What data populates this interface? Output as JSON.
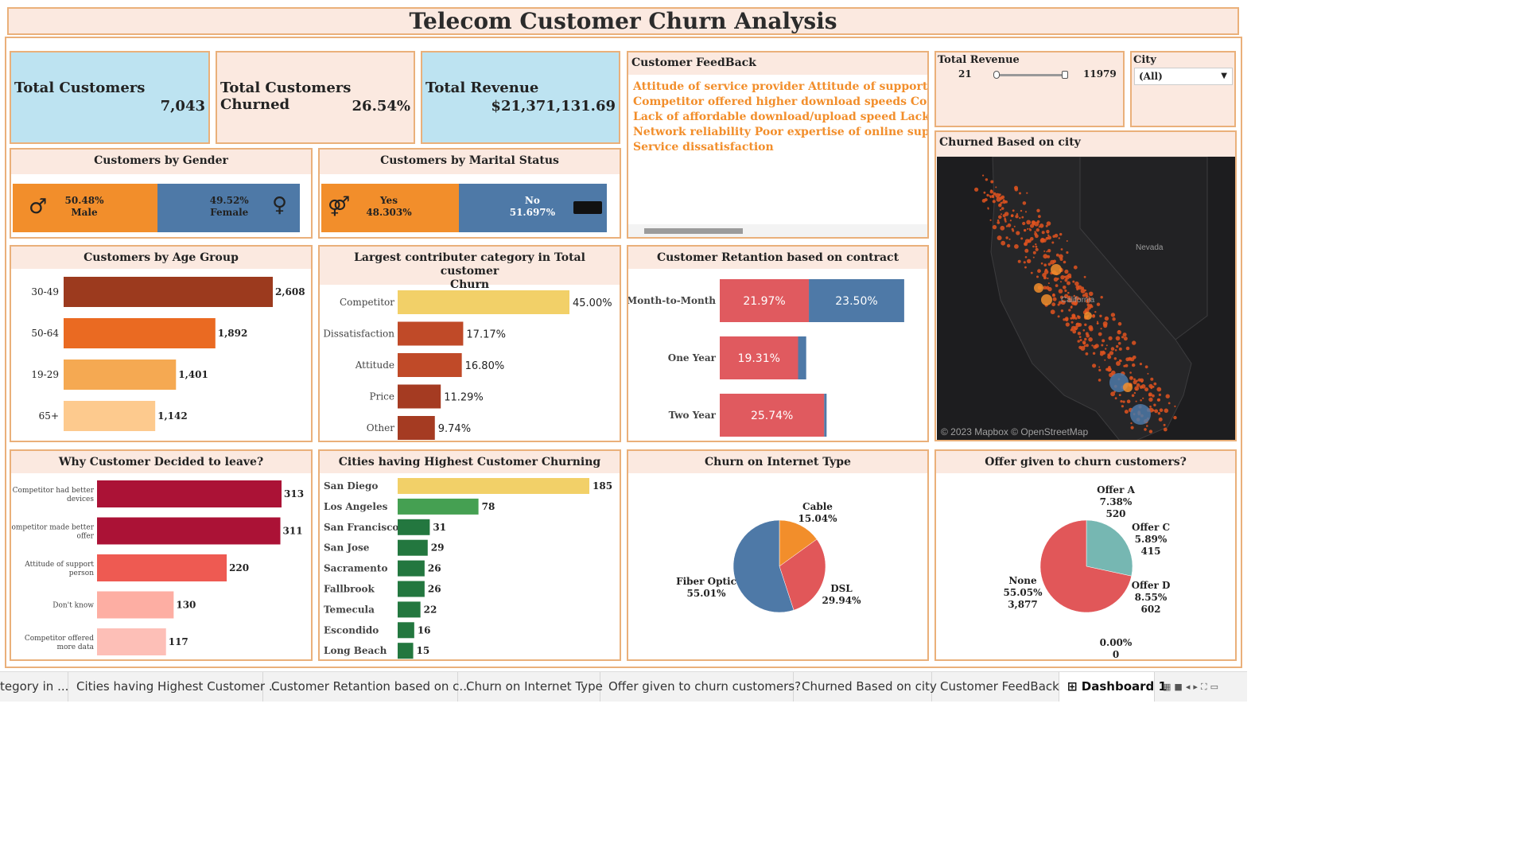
{
  "title": "Telecom Customer Churn Analysis",
  "kpis": {
    "total_customers": {
      "label": "Total Customers",
      "value": "7,043"
    },
    "churned": {
      "label": "Total Customers Churned",
      "value": "26.54%"
    },
    "revenue": {
      "label": "Total Revenue",
      "value": "$21,371,131.69"
    }
  },
  "feedback": {
    "title": "Customer FeedBack",
    "lines": [
      "Attitude of service provider  Attitude of support pers",
      "Competitor offered higher download speeds  Competi",
      "Lack of affordable download/upload speed  Lack of s",
      "Network reliability  Poor expertise of online support  P",
      "Service dissatisfaction"
    ]
  },
  "revenue_filter": {
    "title": "Total Revenue",
    "min": "21",
    "max": "11979"
  },
  "city_filter": {
    "title": "City",
    "value": "(All)"
  },
  "map": {
    "title": "Churned Based on city",
    "state_label": "Nevada",
    "state_label_ca": "California",
    "attribution": "© 2023 Mapbox © OpenStreetMap"
  },
  "gender": {
    "title": "Customers by Gender",
    "male_pct": "50.48%",
    "male_label": "Male",
    "female_pct": "49.52%",
    "female_label": "Female",
    "male_share": 50.48
  },
  "marital": {
    "title": "Customers by Marital Status",
    "yes_label": "Yes",
    "yes_pct": "48.303%",
    "no_label": "No",
    "no_pct": "51.697%",
    "yes_share": 48.303
  },
  "age": {
    "title": "Customers by Age Group",
    "rows": [
      {
        "label": "30-49",
        "value": 2608,
        "text": "2,608",
        "color": "#9c3a1e"
      },
      {
        "label": "50-64",
        "value": 1892,
        "text": "1,892",
        "color": "#ea6a22"
      },
      {
        "label": "19-29",
        "value": 1401,
        "text": "1,401",
        "color": "#f5a952"
      },
      {
        "label": "65+",
        "value": 1142,
        "text": "1,142",
        "color": "#fdca8e"
      }
    ]
  },
  "category": {
    "title_line1": "Largest contributer category in Total customer",
    "title_line2": "Churn",
    "rows": [
      {
        "label": "Competitor",
        "value": 45.0,
        "text": "45.00%",
        "color": "#f2d068"
      },
      {
        "label": "Dissatisfaction",
        "value": 17.17,
        "text": "17.17%",
        "color": "#c04a28"
      },
      {
        "label": "Attitude",
        "value": 16.8,
        "text": "16.80%",
        "color": "#c04a28"
      },
      {
        "label": "Price",
        "value": 11.29,
        "text": "11.29%",
        "color": "#a53b22"
      },
      {
        "label": "Other",
        "value": 9.74,
        "text": "9.74%",
        "color": "#a53b22"
      }
    ]
  },
  "retention": {
    "title": "Customer Retantion based on contract",
    "rows": [
      {
        "label": "Month-to-Month",
        "churned": 21.97,
        "churned_text": "21.97%",
        "stayed": 23.5,
        "stayed_text": "23.50%"
      },
      {
        "label": "One Year",
        "churned": 19.31,
        "churned_text": "19.31%",
        "stayed": 2.0,
        "stayed_text": ""
      },
      {
        "label": "Two Year",
        "churned": 25.74,
        "churned_text": "25.74%",
        "stayed": 0.6,
        "stayed_text": ""
      }
    ],
    "colors": {
      "churned": "#e05a5f",
      "stayed": "#4e79a7"
    }
  },
  "reasons": {
    "title": "Why Customer Decided to leave?",
    "rows": [
      {
        "l1": "Competitor had better",
        "l2": "devices",
        "value": 313,
        "text": "313",
        "color": "#ab1236"
      },
      {
        "l1": "Competitor made better",
        "l2": "offer",
        "value": 311,
        "text": "311",
        "color": "#ab1236"
      },
      {
        "l1": "Attitude of support",
        "l2": "person",
        "value": 220,
        "text": "220",
        "color": "#ee5a52"
      },
      {
        "l1": "Don't know",
        "l2": "",
        "value": 130,
        "text": "130",
        "color": "#fdaea3"
      },
      {
        "l1": "Competitor offered",
        "l2": "more data",
        "value": 117,
        "text": "117",
        "color": "#fdbfb7"
      }
    ]
  },
  "cities": {
    "title": "Cities having Highest Customer Churning",
    "rows": [
      {
        "label": "San Diego",
        "value": 185,
        "text": "185",
        "color": "#f2d068"
      },
      {
        "label": "Los Angeles",
        "value": 78,
        "text": "78",
        "color": "#45a052"
      },
      {
        "label": "San Francisco",
        "value": 31,
        "text": "31",
        "color": "#23773f"
      },
      {
        "label": "San Jose",
        "value": 29,
        "text": "29",
        "color": "#23773f"
      },
      {
        "label": "Sacramento",
        "value": 26,
        "text": "26",
        "color": "#23773f"
      },
      {
        "label": "Fallbrook",
        "value": 26,
        "text": "26",
        "color": "#23773f"
      },
      {
        "label": "Temecula",
        "value": 22,
        "text": "22",
        "color": "#23773f"
      },
      {
        "label": "Escondido",
        "value": 16,
        "text": "16",
        "color": "#23773f"
      },
      {
        "label": "Long Beach",
        "value": 15,
        "text": "15",
        "color": "#23773f"
      }
    ]
  },
  "internet": {
    "title": "Churn on Internet Type",
    "slices": [
      {
        "label": "Cable",
        "pct": "15.04%",
        "value": 15.04,
        "color": "#f28e2b"
      },
      {
        "label": "DSL",
        "pct": "29.94%",
        "value": 29.94,
        "color": "#e15759"
      },
      {
        "label": "Fiber Optic",
        "pct": "55.01%",
        "value": 55.01,
        "color": "#4e79a7"
      }
    ]
  },
  "offers": {
    "title": "Offer given to churn customers?",
    "slices": [
      {
        "label": "Offer A",
        "pct": "7.38%",
        "count": "520",
        "value": 7.38,
        "color": "#76b7b2"
      },
      {
        "label": "Offer C",
        "pct": "5.89%",
        "count": "415",
        "value": 5.89,
        "color": "#76b7b2"
      },
      {
        "label": "Offer D",
        "pct": "8.55%",
        "count": "602",
        "value": 8.55,
        "color": "#76b7b2"
      },
      {
        "label": "",
        "pct": "0.00%",
        "count": "0",
        "value": 0.0,
        "color": "#76b7b2"
      },
      {
        "label": "None",
        "pct": "55.05%",
        "count": "3,877",
        "value": 55.05,
        "color": "#e15759"
      }
    ]
  },
  "tabs": [
    "tegory in ...",
    "Cities having Highest Customer ...",
    "Customer Retantion based on c...",
    "Churn on Internet Type",
    "Offer given to churn customers?",
    "Churned Based on city",
    "Customer FeedBack",
    "⊞ Dashboard 1"
  ]
}
